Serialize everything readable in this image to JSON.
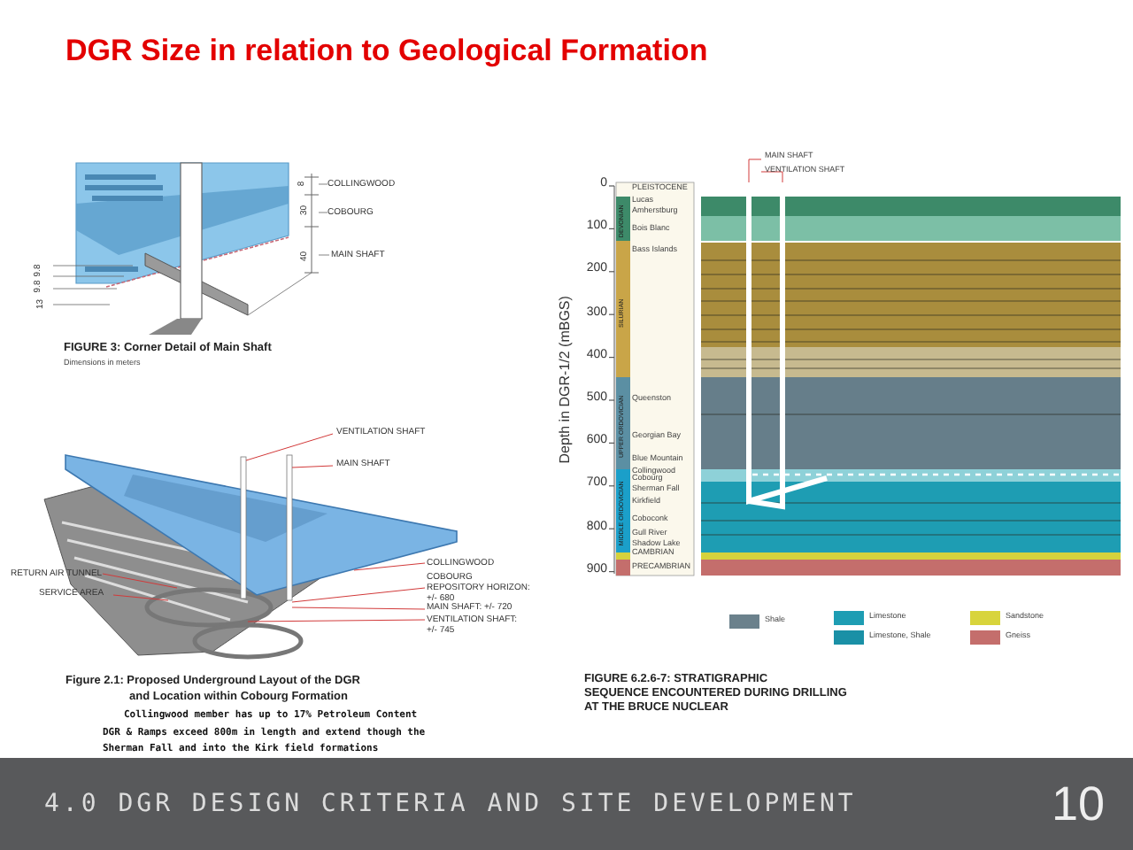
{
  "title": "DGR Size in relation to Geological Formation",
  "figure_shaft": {
    "labels": [
      "COLLINGWOOD",
      "COBOURG",
      "MAIN SHAFT"
    ],
    "dims": [
      "8",
      "30",
      "40"
    ],
    "side_dims": [
      "9.8",
      "9.8",
      "13"
    ],
    "caption": "FIGURE 3: Corner Detail of Main Shaft",
    "note": "Dimensions in meters"
  },
  "figure_layout": {
    "labels": [
      "VENTILATION SHAFT",
      "MAIN SHAFT",
      "RETURN AIR TUNNEL",
      "SERVICE AREA",
      "COLLINGWOOD",
      "COBOURG",
      "REPOSITORY HORIZON:",
      "+/- 680",
      "MAIN SHAFT: +/- 720",
      "VENTILATION SHAFT:",
      "+/- 745"
    ],
    "caption_lines": [
      "Figure 2.1:  Proposed Underground Layout of the DGR",
      "and Location within Cobourg Formation"
    ]
  },
  "notes": [
    {
      "lines": [
        "Collingwood member has up to 17% Petroleum Content"
      ]
    },
    {
      "lines": [
        "DGR & Ramps exceed 800m in length and extend though the",
        "Sherman Fall and into the Kirk field formations"
      ]
    }
  ],
  "strat": {
    "shaft_labels": [
      "MAIN SHAFT",
      "VENTILATION SHAFT"
    ],
    "axis_label": "Depth in DGR-1/2 (mBGS)",
    "ticks": [
      "0",
      "100",
      "200",
      "300",
      "400",
      "500",
      "600",
      "700",
      "800",
      "900"
    ],
    "periods": [
      "DEVONIAN",
      "SILURIAN",
      "UPPER ORDOVICIAN",
      "MIDDLE ORDOVICIAN"
    ],
    "formations": [
      "PLEISTOCENE",
      "Lucas",
      "Amherstburg",
      "Bois Blanc",
      "Bass Islands",
      "Queenston",
      "Georgian Bay",
      "Blue Mountain",
      "Collingwood",
      "Cobourg",
      "Sherman Fall",
      "Kirkfield",
      "Coboconk",
      "Gull River",
      "Shadow Lake",
      "CAMBRIAN",
      "PRECAMBRIAN"
    ],
    "legend": [
      {
        "label": "Shale",
        "color": "#6b818c"
      },
      {
        "label": "Limestone",
        "color": "#1e9db3"
      },
      {
        "label": "Limestone, Shale",
        "color": "#1a90a6"
      },
      {
        "label": "Sandstone",
        "color": "#d8d43c"
      },
      {
        "label": "Gneiss",
        "color": "#c46e6c"
      }
    ],
    "caption_lines": [
      "FIGURE 6.2.6-7: STRATIGRAPHIC",
      "SEQUENCE ENCOUNTERED DURING DRILLING",
      "AT THE BRUCE NUCLEAR"
    ]
  },
  "footer": {
    "section": "4.0 DGR DESIGN CRITERIA AND SITE DEVELOPMENT",
    "page": "10"
  }
}
